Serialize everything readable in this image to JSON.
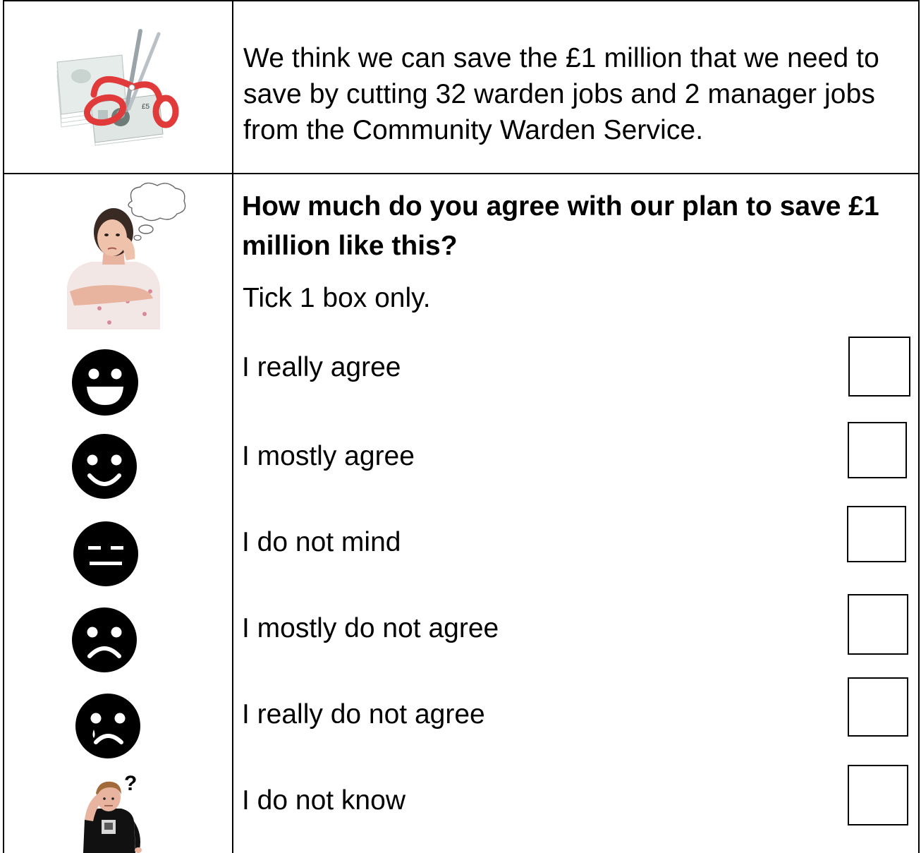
{
  "intro": {
    "text": "We think we can save the £1 million that we need to save by cutting 32 warden jobs and 2 manager jobs from the Community Warden Service.",
    "image": "money-cut-scissors-picture",
    "banknote_text": "£5"
  },
  "question": {
    "text": "How much do you agree with our plan to save £1 million like this?",
    "instruction": "Tick 1 box only.",
    "image": "thinking-woman-picture"
  },
  "options": [
    {
      "label": "I really agree",
      "icon": "big-smile-face-icon",
      "checked": false
    },
    {
      "label": "I mostly agree",
      "icon": "smile-face-icon",
      "checked": false
    },
    {
      "label": "I do not mind",
      "icon": "neutral-face-icon",
      "checked": false
    },
    {
      "label": "I mostly do not agree",
      "icon": "sad-face-icon",
      "checked": false
    },
    {
      "label": "I really do not agree",
      "icon": "crying-face-icon",
      "checked": false
    },
    {
      "label": "I do not know",
      "icon": "confused-person-picture",
      "checked": false
    }
  ],
  "colors": {
    "border": "#000000",
    "scissors": "#e03a3a",
    "banknote": "#dfe6e4"
  }
}
